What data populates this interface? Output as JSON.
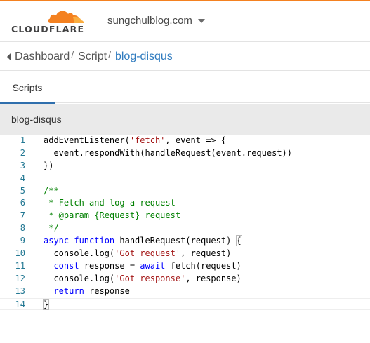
{
  "brand": {
    "name": "CLOUDFLARE",
    "colors": {
      "accent": "#f48120",
      "accent_light": "#faad3f",
      "link": "#2f7bbf",
      "tab_indicator": "#2f6fad"
    }
  },
  "header": {
    "account_name": "sungchulblog.com",
    "account_icon": "chevron-down-icon"
  },
  "breadcrumb": {
    "items": [
      "Dashboard",
      "Script",
      "blog-disqus"
    ],
    "separator": "/",
    "back_icon": "chevron-left-icon"
  },
  "tabs": [
    {
      "label": "Scripts",
      "active": true
    }
  ],
  "editor": {
    "title": "blog-disqus",
    "lines": [
      {
        "n": "1",
        "text": "addEventListener('fetch', event => {"
      },
      {
        "n": "2",
        "text": "  event.respondWith(handleRequest(event.request))"
      },
      {
        "n": "3",
        "text": "})"
      },
      {
        "n": "4",
        "text": ""
      },
      {
        "n": "5",
        "text": "/**"
      },
      {
        "n": "6",
        "text": " * Fetch and log a request"
      },
      {
        "n": "7",
        "text": " * @param {Request} request"
      },
      {
        "n": "8",
        "text": " */"
      },
      {
        "n": "9",
        "text": "async function handleRequest(request) {"
      },
      {
        "n": "10",
        "text": "  console.log('Got request', request)"
      },
      {
        "n": "11",
        "text": "  const response = await fetch(request)"
      },
      {
        "n": "12",
        "text": "  console.log('Got response', response)"
      },
      {
        "n": "13",
        "text": "  return response"
      },
      {
        "n": "14",
        "text": "}"
      }
    ]
  }
}
